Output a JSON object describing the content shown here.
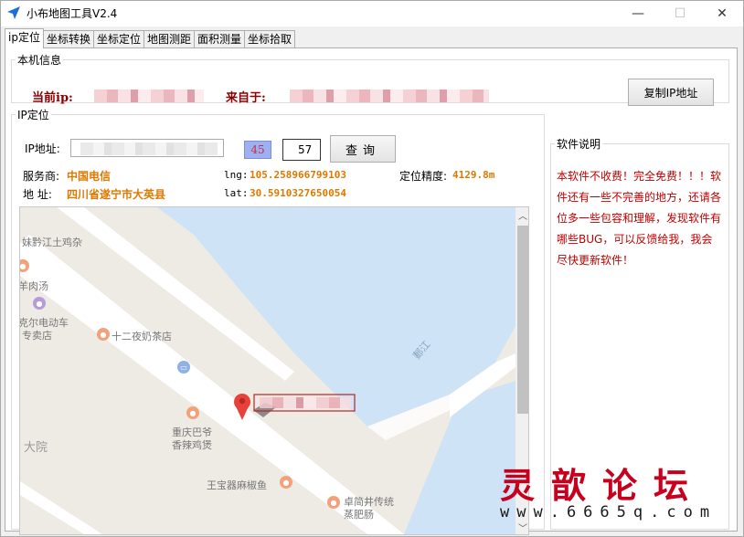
{
  "window": {
    "title": "小布地图工具V2.4",
    "minimize": "—",
    "maximize": "☐",
    "close": "✕"
  },
  "tabs": [
    {
      "label": "ip定位",
      "active": true
    },
    {
      "label": "坐标转换",
      "active": false
    },
    {
      "label": "坐标定位",
      "active": false
    },
    {
      "label": "地图测距",
      "active": false
    },
    {
      "label": "面积测量",
      "active": false
    },
    {
      "label": "坐标拾取",
      "active": false
    }
  ],
  "local_info": {
    "legend": "本机信息",
    "ip_label": "当前ip:",
    "from_label": "来自于:",
    "copy_button": "复制IP地址"
  },
  "ip_locate": {
    "legend": "IP定位",
    "ip_label": "IP地址:",
    "captcha_text": "45",
    "code_value": "57",
    "query_button": "查询",
    "isp_label": "服务商:",
    "isp_value": "中国电信",
    "addr_label": "地 址:",
    "addr_value": "四川省遂宁市大英县",
    "lng_label": "lng:",
    "lng_value": "105.258966799103",
    "lat_label": "lat:",
    "lat_value": "30.5910327650054",
    "precision_label": "定位精度:",
    "precision_value": "4129.8m"
  },
  "map": {
    "labels": [
      "妹黔江土鸡杂",
      "羊肉汤",
      "克尔电动车",
      "专卖店",
      "十二夜奶茶店",
      "重庆巴爷",
      "香辣鸡煲",
      "大院",
      "王宝器麻椒鱼",
      "卓简井传统",
      "蒸肥肠",
      "郪江"
    ],
    "scroll_up": "︿",
    "scroll_down": "﹀"
  },
  "about": {
    "legend": "软件说明",
    "text": "本软件不收费！完全免费！！！软件还有一些不完善的地方，还请各位多一些包容和理解，发现软件有哪些BUG，可以反馈给我，我会尽快更新软件！"
  },
  "watermark": {
    "title": "灵歆论坛",
    "url": "www.6665q.com"
  },
  "colors": {
    "accent_red": "#8b0000",
    "value_orange": "#e07800",
    "about_red": "#c00000",
    "water": "#cfe3f7",
    "land": "#eeebe5"
  }
}
